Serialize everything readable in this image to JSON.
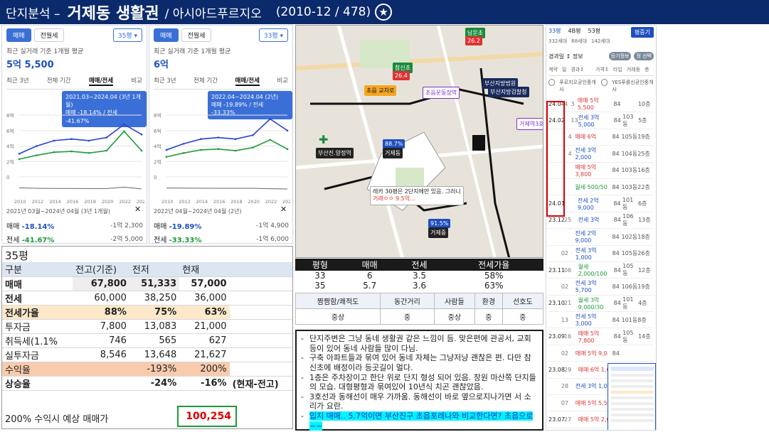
{
  "header": {
    "prefix": "단지분석 –",
    "title": "거제동 생활권",
    "subtitle": "/ 아시아드푸르지오",
    "meta": "(2010-12 / 478)",
    "star": "★"
  },
  "left_chart_a": {
    "tab_sale": "매매",
    "tab_rent": "전월세",
    "size": "35평 ▾",
    "note": "최근 실거래 기준 1개월 평균",
    "price": "5억 5,500",
    "periods": [
      "최근 3년",
      "전체 기간",
      "매매/전세",
      "비교"
    ],
    "tip_line1": "2021.03~2024.04 (3년 1개월)",
    "tip_line2": "매매 -18.14% / 전세 -41.67%",
    "y_ticks": [
      "8억",
      "6억",
      "4억",
      "2억",
      "0"
    ],
    "rent_label": "전세가율",
    "x_ticks": [
      "2010",
      "2012",
      "2014",
      "2016",
      "2018",
      "2020",
      "2022",
      "2024"
    ],
    "range": "2021년 03월~2024년 04월 (3년 1개월)",
    "close": "✕",
    "sale_label": "매매",
    "sale_pct": "-18.14%",
    "sale_amt": "-1억 2,300",
    "jeonse_label": "전세",
    "jeonse_pct": "-41.67%",
    "jeonse_amt": "-2억 5,000"
  },
  "left_chart_b": {
    "tab_sale": "매매",
    "tab_rent": "전월세",
    "size": "33평 ▾",
    "note": "최근 실거래 기준 1개월 평균",
    "price": "6억",
    "periods": [
      "최근 3년",
      "전체 기간",
      "매매/전세",
      "비교"
    ],
    "tip_line1": "2022.04~2024.04 (2년)",
    "tip_line2": "매매 -19.89% / 전세 -33.33%",
    "y_ticks": [
      "8억",
      "6억",
      "4억",
      "2억",
      "0"
    ],
    "x_ticks": [
      "2010",
      "2012",
      "2014",
      "2016",
      "2018",
      "2020",
      "2022",
      "2024"
    ],
    "range": "2022년 04월~2024년 04월 (2년)",
    "close": "✕",
    "sale_label": "매매",
    "sale_pct": "-19.89%",
    "sale_amt": "-1억 4,900",
    "jeonse_label": "전세",
    "jeonse_pct": "-33.33%",
    "jeonse_amt": "-1억 6,000"
  },
  "chart_data": [
    {
      "type": "line",
      "x": [
        "2010",
        "2012",
        "2014",
        "2016",
        "2018",
        "2020",
        "2022",
        "2024"
      ],
      "series": [
        {
          "name": "매매",
          "values": [
            3.0,
            4.0,
            4.7,
            4.9,
            4.7,
            5.1,
            6.8,
            5.5
          ]
        },
        {
          "name": "전세",
          "values": [
            2.3,
            2.8,
            3.2,
            3.3,
            3.1,
            3.4,
            5.9,
            3.4
          ]
        }
      ],
      "ylim": [
        0,
        8
      ],
      "xlabel": "",
      "ylabel": ""
    },
    {
      "type": "line",
      "x": [
        "2010",
        "2012",
        "2014",
        "2016",
        "2018",
        "2020",
        "2022",
        "2024"
      ],
      "series": [
        {
          "name": "매매",
          "values": [
            3.5,
            4.3,
            4.9,
            5.1,
            4.9,
            5.4,
            7.5,
            6.0
          ]
        },
        {
          "name": "전세",
          "values": [
            2.6,
            3.1,
            3.5,
            3.6,
            3.4,
            3.8,
            4.8,
            3.6
          ]
        }
      ],
      "ylim": [
        0,
        8
      ],
      "xlabel": "",
      "ylabel": ""
    }
  ],
  "summary_table": {
    "title": "35평",
    "headers": [
      "구분",
      "전고(기준)",
      "전저",
      "현재"
    ],
    "rows": [
      [
        "매매",
        "67,800",
        "51,333",
        "57,000"
      ],
      [
        "전세",
        "60,000",
        "38,250",
        "36,000"
      ],
      [
        "전세가율",
        "88%",
        "75%",
        "63%"
      ],
      [
        "투자금",
        "7,800",
        "13,083",
        "21,000"
      ],
      [
        "취득세(1.1%",
        "746",
        "565",
        "627"
      ],
      [
        "실투자금",
        "8,546",
        "13,648",
        "21,627"
      ],
      [
        "수익율",
        "",
        "-193%",
        "200%"
      ],
      [
        "상승율",
        "",
        "-24%",
        "-16%"
      ]
    ],
    "rise_note": "(현재-전고)",
    "forecast_label": "200% 수익시 예상 매매가",
    "forecast_value": "100,254"
  },
  "map": {
    "labels": [
      "남문초",
      "참신초",
      "초읍 교차로",
      "초읍운동장역",
      "부산지방법원",
      "부산지방검찰청",
      "거제역3호선",
      "부산진.양정역",
      "아시아드",
      "91.5%",
      "88.7%",
      "거제동",
      "거제중",
      "26.2",
      "26.4"
    ],
    "popup_line1": "레카 30평은 2단지에만 있음. 그러니",
    "popup_line2": "거래ㅇㅇ 9.5억..."
  },
  "size_table": {
    "headers": [
      "평형",
      "매매",
      "전세",
      "전세가율"
    ],
    "rows": [
      [
        "33",
        "6",
        "3.5",
        "58%"
      ],
      [
        "35",
        "5.7",
        "3.6",
        "63%"
      ]
    ]
  },
  "eval_table": {
    "headers": [
      "짬짬함/쾌적도",
      "동간거리",
      "사람들",
      "환경",
      "선호도"
    ],
    "values": [
      "중상",
      "중",
      "중상",
      "중",
      "중"
    ]
  },
  "notes": [
    "단지주변은 그냥 동네 생활권 같은 느낌이 듬. 맞은편에 관공서, 교회등이 있어 동네 사람들 많이 다님.",
    "구축 아파트들과 묶여 있어 동네 자체는 그냥저냥 괜찮은 편. 다만 참신초에 배정이라 등곳길이 멀다.",
    "1층은 주차장이고 한단 위로 단지 형성 되어 있음. 창원 마산쪽 단지들의 모습. 대형평형과 묶여있어 10년식 치곤 괜찮았음.",
    "3호선과 동해선이 매우 가까움. 동해선이 바로 옆으로지나가면 서 소리가 요란.",
    "입지 매매.. 5.7억이면 부산진구 초읍포레나와 비교한다면? 초읍으로~~"
  ],
  "right_panel": {
    "tabs": [
      "33평",
      "4B평",
      "53평"
    ],
    "sub": [
      "332세대",
      "68세대",
      "142세대"
    ],
    "button": "평증기",
    "filter": "경과일 ↕ 정보",
    "chip1": "등기정보",
    "chip2": "정 선택",
    "cols": [
      "계약",
      "일",
      "경과↕",
      "가격↕",
      "타입",
      "거래동",
      "층"
    ],
    "brokers": [
      "푸르지오공인중개사",
      "YES푸를신공인중개사"
    ],
    "rows": [
      [
        "24.04",
        "4",
        "3",
        "매매 5억 5,500",
        "84",
        "",
        "10층"
      ],
      [
        "24.02",
        "",
        "13",
        "전세 3억 5,000",
        "84",
        "103동",
        "5층"
      ],
      [
        "",
        "",
        "4",
        "매매 6억",
        "84",
        "105동",
        "19층"
      ],
      [
        "",
        "",
        "4",
        "전세 3억 2,000",
        "84",
        "104동",
        "25층"
      ],
      [
        "",
        "",
        "",
        "매매 5억 3,800",
        "84",
        "103동",
        "16층"
      ],
      [
        "",
        "",
        "",
        "월세 500/50",
        "84",
        "103동",
        "22층"
      ],
      [
        "24.01",
        "",
        "",
        "전세 2억 9,000",
        "84",
        "101동",
        "6층"
      ],
      [
        "23.12",
        "25",
        "",
        "전세 3억",
        "84",
        "106동",
        "13층"
      ],
      [
        "",
        "",
        "",
        "전세 2억 9,000",
        "84",
        "102동",
        "18층"
      ],
      [
        "",
        "02",
        "",
        "전세 3억 1,000",
        "84",
        "105동",
        "26층"
      ],
      [
        "23.11",
        "06",
        "",
        "월세 2,000/100",
        "84",
        "105동",
        "12층"
      ],
      [
        "",
        "02",
        "",
        "전세 3억 5,700",
        "84",
        "106동",
        "19층"
      ],
      [
        "23.10",
        "21",
        "",
        "월세 3억 9,000/30",
        "84",
        "101동",
        "4층"
      ],
      [
        "",
        "13",
        "",
        "전세 5억 3,000",
        "84",
        "101동",
        "8층"
      ],
      [
        "23.09",
        "16",
        "",
        "매매 5억 7,800",
        "84",
        "105동",
        "14층"
      ],
      [
        "",
        "02",
        "",
        "매매 5억 9,0",
        "84",
        "",
        ""
      ],
      [
        "23.08",
        "29",
        "",
        "매매 6억 1,0",
        "84",
        "",
        ""
      ],
      [
        "",
        "28",
        "",
        "전세 3억 1,0",
        "84",
        "",
        ""
      ],
      [
        "",
        "07",
        "",
        "매매 5억 5,5",
        "84",
        "",
        ""
      ],
      [
        "23.07",
        "27",
        "",
        "매매 5억 2,0",
        "84",
        "",
        ""
      ]
    ]
  }
}
